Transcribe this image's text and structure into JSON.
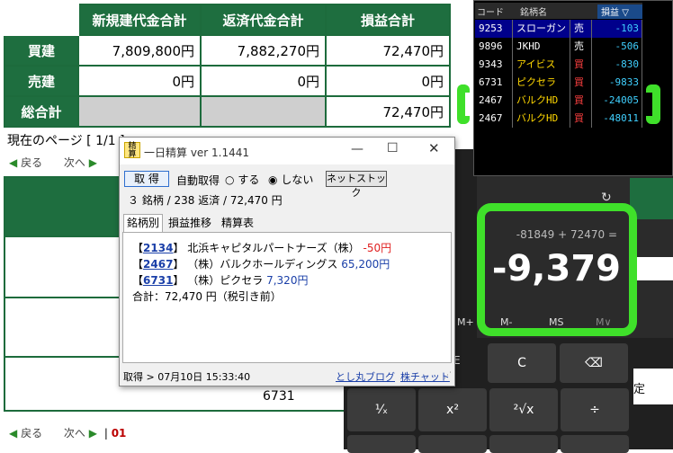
{
  "summary": {
    "headers": [
      "新規建代金合計",
      "返済代金合計",
      "損益合計"
    ],
    "rows": [
      {
        "label": "買建",
        "values": [
          "7,809,800円",
          "7,882,270円",
          "72,470円"
        ]
      },
      {
        "label": "売建",
        "values": [
          "0円",
          "0円",
          "0円"
        ]
      },
      {
        "label": "総合計",
        "values": [
          "",
          "",
          "72,470円"
        ]
      }
    ]
  },
  "page_indicator": "現在のページ [ 1/1 ]",
  "nav": {
    "back": "戻る",
    "next": "次へ",
    "page": "01"
  },
  "lower_table": {
    "cell_code": "6731",
    "side_text_1": "定"
  },
  "stock_panel": {
    "headers": [
      "コード",
      "銘柄名",
      "",
      "損益"
    ],
    "filter_icon": "▽",
    "rows": [
      {
        "code": "9253",
        "name": "スローガン",
        "side": "売",
        "pl": "-103"
      },
      {
        "code": "9896",
        "name": "JKHD",
        "side": "売",
        "pl": "-506"
      },
      {
        "code": "9343",
        "name": "アイビス",
        "side": "買",
        "pl": "-830"
      },
      {
        "code": "6731",
        "name": "ピクセラ",
        "side": "買",
        "pl": "-9833"
      },
      {
        "code": "2467",
        "name": "バルクHD",
        "side": "買",
        "pl": "-24005"
      },
      {
        "code": "2467",
        "name": "バルクHD",
        "side": "買",
        "pl": "-48011"
      }
    ]
  },
  "calculator": {
    "expression": "-81849 + 72470 =",
    "result": "-9,379",
    "memory_keys": [
      "M+",
      "M-",
      "MS",
      "M∨"
    ],
    "keys_row1": [
      "E",
      "C",
      "⌫"
    ],
    "keys_row2": [
      "¹⁄ₓ",
      "x²",
      "²√x",
      "÷"
    ]
  },
  "app_window": {
    "title": "一日精算 ver 1.1441",
    "fetch_button": "取 得",
    "auto_fetch_label": "自動取得",
    "radio_yes": "する",
    "radio_no": "しない",
    "net_stock_button": "ネットストック",
    "summary_line": "３ 銘柄 / 238 返済 / 72,470 円",
    "tabs": [
      "銘柄別",
      "損益推移",
      "精算表"
    ],
    "entries": [
      {
        "code": "2134",
        "name": "北浜キャピタルパートナーズ（株）",
        "amount": "-50円"
      },
      {
        "code": "2467",
        "name": "（株）バルクホールディングス",
        "amount": "65,200円"
      },
      {
        "code": "6731",
        "name": "（株）ピクセラ",
        "amount": "7,320円"
      }
    ],
    "total_line": "合計：72,470 円（税引き前）",
    "status_text": "取得 > 07月10日 15:33:40",
    "link_blog": "とし丸ブログ",
    "link_chat": "株チャット"
  },
  "colors": {
    "table_green": "#1e6e3f",
    "highlight": "#3fe02a",
    "loss_red": "#e02020",
    "profit_blue": "#1a3fa8"
  }
}
